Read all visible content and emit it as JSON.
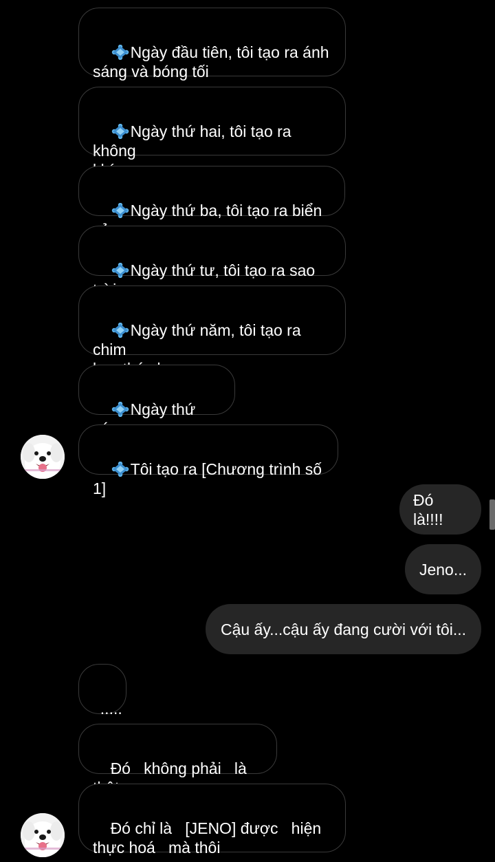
{
  "colors": {
    "background": "#000000",
    "incoming_border": "#3a3a3a",
    "outgoing_bubble": "#262626",
    "text": "#ffffff",
    "gem": "#4aa3df"
  },
  "messages": [
    {
      "side": "incoming",
      "icon": "blue-diamond-icon",
      "text": "Ngày đầu tiên, tôi tạo ra ánh\nsáng và bóng tối"
    },
    {
      "side": "incoming",
      "icon": "blue-diamond-icon",
      "text": "Ngày thứ hai, tôi tạo ra không\nkhí"
    },
    {
      "side": "incoming",
      "icon": "blue-diamond-icon",
      "text": "Ngày thứ ba, tôi tạo ra biển cả"
    },
    {
      "side": "incoming",
      "icon": "blue-diamond-icon",
      "text": "Ngày thứ tư, tôi tạo ra sao trời"
    },
    {
      "side": "incoming",
      "icon": "blue-diamond-icon",
      "text": "Ngày thứ năm, tôi tạo ra chim\nbay thú chạy"
    },
    {
      "side": "incoming",
      "icon": "blue-diamond-icon",
      "text": "Ngày thứ sáu..."
    },
    {
      "side": "incoming",
      "icon": "blue-diamond-icon",
      "text": "Tôi tạo ra [Chương trình số 1]"
    },
    {
      "side": "outgoing",
      "text": "Đó là!!!!"
    },
    {
      "side": "outgoing",
      "text": "Jeno..."
    },
    {
      "side": "outgoing",
      "text": "Cậu ấy...cậu ấy đang cười với tôi..."
    },
    {
      "side": "incoming",
      "text": "....."
    },
    {
      "side": "incoming",
      "text": "Đó   không phải   là thật"
    },
    {
      "side": "incoming",
      "text": "Đó chỉ là   [JENO] được   hiện\nthực hoá   mà thôi"
    }
  ],
  "avatars": [
    {
      "icon": "dog-avatar-icon"
    },
    {
      "icon": "dog-avatar-icon"
    }
  ]
}
